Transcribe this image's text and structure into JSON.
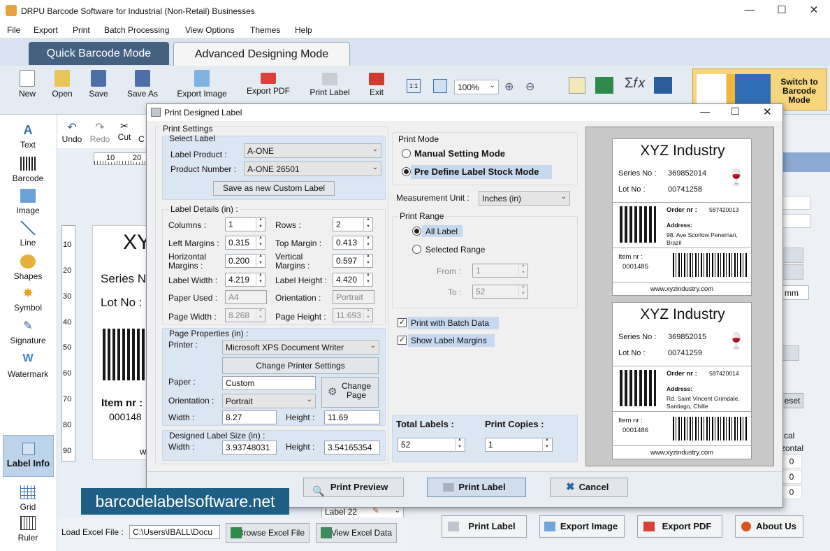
{
  "window": {
    "title": "DRPU Barcode Software for Industrial (Non-Retail) Businesses",
    "minimize": "—",
    "maximize": "☐",
    "close": "✕"
  },
  "menu": [
    "File",
    "Export",
    "Print",
    "Batch Processing",
    "View Options",
    "Themes",
    "Help"
  ],
  "modes": {
    "quick": "Quick Barcode Mode",
    "advanced": "Advanced Designing Mode"
  },
  "toolbar": {
    "new": "New",
    "open": "Open",
    "save": "Save",
    "save_as": "Save As",
    "export_image": "Export Image",
    "export_pdf": "Export PDF",
    "print_label": "Print Label",
    "exit": "Exit",
    "zoom": "100%",
    "switch": "Switch to Barcode Mode"
  },
  "edit_toolbar": {
    "undo": "Undo",
    "redo": "Redo",
    "cut": "Cut",
    "copy": "C"
  },
  "sidebar": [
    "Text",
    "Barcode",
    "Image",
    "Line",
    "Shapes",
    "Symbol",
    "Signature",
    "Watermark",
    "Label Info",
    "Grid",
    "Ruler"
  ],
  "canvas": {
    "ruler_top": [
      "10",
      "20"
    ],
    "ruler_left": [
      "10",
      "20",
      "30",
      "40",
      "50",
      "60",
      "70",
      "80",
      "90"
    ],
    "heading": "XY",
    "series": "Series N",
    "lot": "Lot No :",
    "item": "Item nr :",
    "item_val": "000148",
    "foot": "w",
    "label_name": "Label 22"
  },
  "bottom": {
    "load_excel": "Load Excel File :",
    "excel_path": "C:\\Users\\IBALL\\Docu",
    "browse": "Browse Excel File",
    "view": "View Excel Data",
    "print_label": "Print Label",
    "export_image": "Export Image",
    "export_pdf": "Export PDF",
    "about": "About Us"
  },
  "right_bits": {
    "mm": "mm",
    "reset": "eset",
    "cal": "cal",
    "zontal": "zontal",
    "zero": "0"
  },
  "watermark": "barcodelabelsoftware.net",
  "dialog": {
    "title": "Print Designed Label",
    "print_settings": "Print Settings",
    "select_label": "Select Label",
    "label_product_lbl": "Label Product :",
    "label_product": "A-ONE",
    "product_number_lbl": "Product Number :",
    "product_number": "A-ONE 26501",
    "save_custom": "Save as new Custom Label",
    "label_details": "Label Details (in) :",
    "columns_lbl": "Columns :",
    "columns": "1",
    "rows_lbl": "Rows :",
    "rows": "2",
    "left_margins_lbl": "Left Margins :",
    "left_margins": "0.315",
    "top_margin_lbl": "Top Margin :",
    "top_margin": "0.413",
    "h_margins_lbl1": "Horizontal",
    "h_margins_lbl2": "Margins :",
    "h_margins": "0.200",
    "v_margins_lbl1": "Vertical",
    "v_margins_lbl2": "Margins :",
    "v_margins": "0.597",
    "label_width_lbl": "Label Width :",
    "label_width": "4.219",
    "label_height_lbl": "Label Height :",
    "label_height": "4.420",
    "paper_used_lbl": "Paper Used :",
    "paper_used": "A4",
    "orientation_lbl": "Orientation :",
    "orientation": "Portrait",
    "page_width_lbl": "Page Width :",
    "page_width": "8.268",
    "page_height_lbl": "Page Height :",
    "page_height": "11.693",
    "page_props": "Page Properties (in) :",
    "printer_lbl": "Printer :",
    "printer": "Microsoft XPS Document Writer",
    "change_printer": "Change Printer Settings",
    "paper_lbl": "Paper :",
    "paper": "Custom",
    "change_page": "Change Page",
    "orient2_lbl": "Orientation :",
    "orient2": "Portrait",
    "width_lbl": "Width :",
    "width": "8.27",
    "height_lbl": "Height :",
    "height": "11.69",
    "designed_size": "Designed Label Size (in) :",
    "dwidth_lbl": "Width :",
    "dwidth": "3.93748031",
    "dheight_lbl": "Height :",
    "dheight": "3.54165354",
    "print_mode": "Print Mode",
    "manual": "Manual Setting Mode",
    "predefine": "Pre Define Label Stock Mode",
    "measurement_lbl": "Measurement Unit :",
    "measurement": "Inches (in)",
    "print_range": "Print Range",
    "all_label": "All Label",
    "selected_range": "Selected Range",
    "from_lbl": "From :",
    "from": "1",
    "to_lbl": "To :",
    "to": "52",
    "batch": "Print with Batch Data",
    "show_margins": "Show Label Margins",
    "total_lbl": "Total Labels :",
    "total": "52",
    "copies_lbl": "Print Copies :",
    "copies": "1",
    "preview_btn": "Print Preview",
    "print_btn": "Print Label",
    "cancel_btn": "Cancel",
    "labels": [
      {
        "company": "XYZ Industry",
        "series_lbl": "Series No :",
        "series": "369852014",
        "lot_lbl": "Lot No :",
        "lot": "00741258",
        "order_lbl": "Order nr :",
        "order": "587420013",
        "address_lbl": "Address:",
        "address1": "98, Ave Scorlow Peneman,",
        "address2": "Brazil",
        "item_lbl": "Item nr :",
        "item": "0001485",
        "web": "www.xyzindustry.com"
      },
      {
        "company": "XYZ Industry",
        "series_lbl": "Series No :",
        "series": "369852015",
        "lot_lbl": "Lot No :",
        "lot": "00741259",
        "order_lbl": "Order nr :",
        "order": "587420014",
        "address_lbl": "Address:",
        "address1": "Rd. Saint Vincent Grimdale,",
        "address2": "Santiago, Chille",
        "item_lbl": "Item nr :",
        "item": "0001486",
        "web": "www.xyzindustry.com"
      }
    ]
  }
}
